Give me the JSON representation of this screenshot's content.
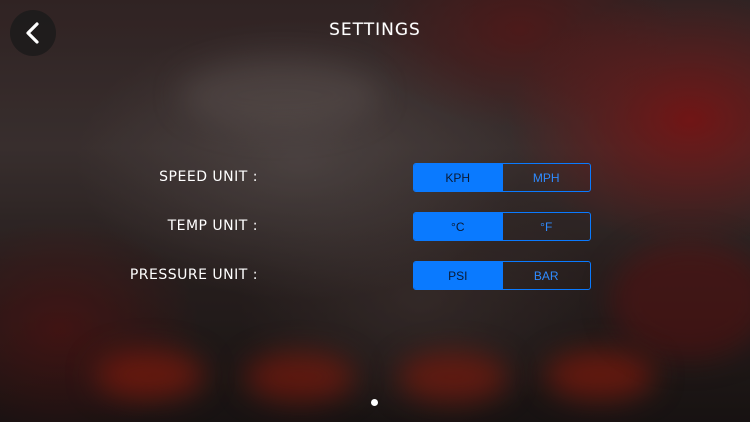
{
  "header": {
    "title": "SETTINGS",
    "back_icon": "chevron-left-icon"
  },
  "settings": [
    {
      "label": "SPEED UNIT :",
      "options": [
        "KPH",
        "MPH"
      ],
      "selected": "KPH"
    },
    {
      "label": "TEMP UNIT :",
      "options": [
        "°C",
        "°F"
      ],
      "selected": "°C"
    },
    {
      "label": "PRESSURE UNIT :",
      "options": [
        "PSI",
        "BAR"
      ],
      "selected": "PSI"
    }
  ],
  "pagination": {
    "page_count": 1,
    "current_page": 1
  },
  "colors": {
    "accent": "#0a7aff",
    "text": "#ffffff",
    "back_button_bg": "#191919"
  }
}
